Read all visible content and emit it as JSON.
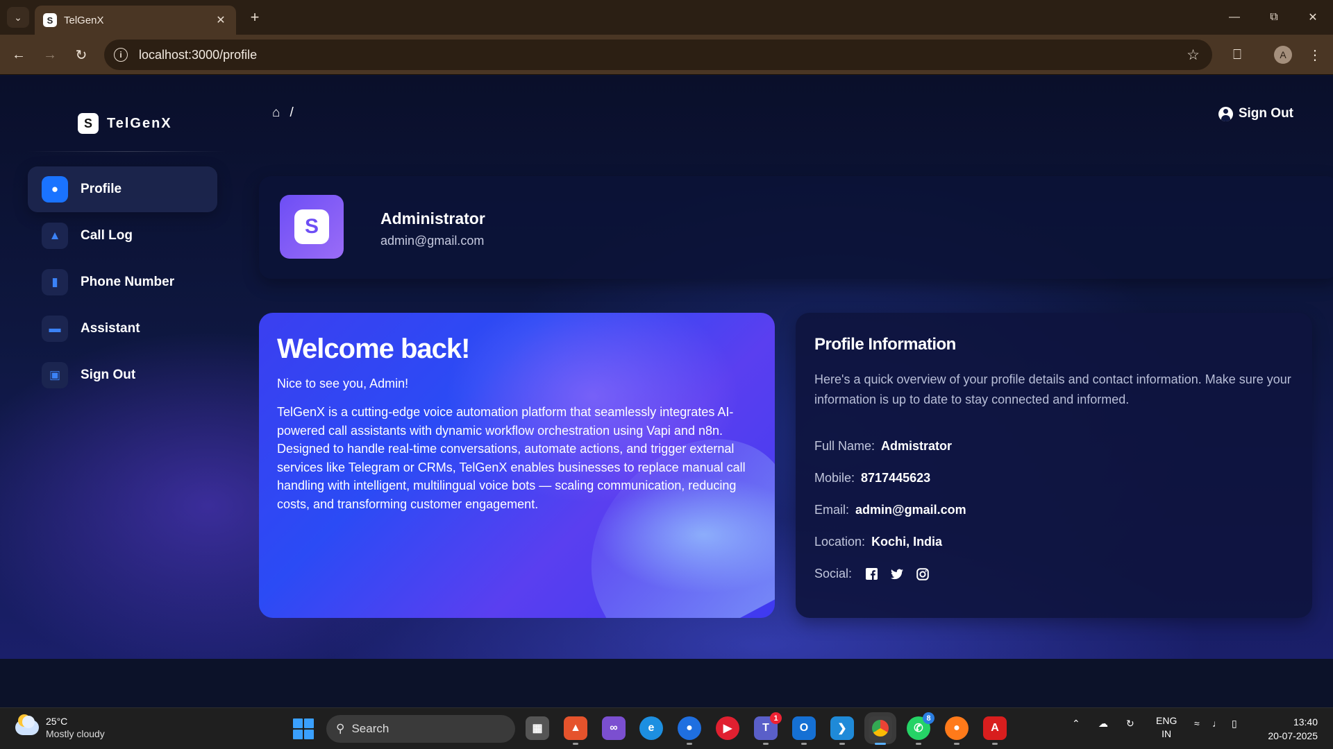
{
  "browser": {
    "tab_title": "TelGenX",
    "url": "localhost:3000/profile",
    "profile_initial": "A"
  },
  "app": {
    "brand": "TelGenX",
    "brand_logo": "S",
    "breadcrumb_sep": "/",
    "signout_top": "Sign Out",
    "sidebar": [
      {
        "label": "Profile",
        "icon": "user-icon",
        "active": true
      },
      {
        "label": "Call Log",
        "icon": "megaphone-icon",
        "active": false
      },
      {
        "label": "Phone Number",
        "icon": "bar-chart-icon",
        "active": false
      },
      {
        "label": "Assistant",
        "icon": "card-icon",
        "active": false
      },
      {
        "label": "Sign Out",
        "icon": "document-icon",
        "active": false
      }
    ],
    "header": {
      "name": "Administrator",
      "email": "admin@gmail.com",
      "avatar_glyph": "S"
    },
    "welcome": {
      "title": "Welcome back!",
      "subtitle": "Nice to see you, Admin!",
      "body": "TelGenX is a cutting-edge voice automation platform that seamlessly integrates AI-powered call assistants with dynamic workflow orchestration using Vapi and n8n. Designed to handle real-time conversations, automate actions, and trigger external services like Telegram or CRMs, TelGenX enables businesses to replace manual call handling with intelligent, multilingual voice bots — scaling communication, reducing costs, and transforming customer engagement."
    },
    "profile_info": {
      "title": "Profile Information",
      "description": "Here's a quick overview of your profile details and contact information. Make sure your information is up to date to stay connected and informed.",
      "full_name_label": "Full Name:",
      "full_name": "Admistrator",
      "mobile_label": "Mobile:",
      "mobile": "8717445623",
      "email_label": "Email:",
      "email": "admin@gmail.com",
      "location_label": "Location:",
      "location": "Kochi, India",
      "social_label": "Social:",
      "social": [
        "facebook-icon",
        "twitter-icon",
        "instagram-icon"
      ]
    }
  },
  "taskbar": {
    "temperature": "25°C",
    "weather": "Mostly cloudy",
    "search": "Search",
    "lang": "ENG",
    "region": "IN",
    "time": "13:40",
    "date": "20-07-2025",
    "teams_badge": "1",
    "whatsapp_badge": "8"
  },
  "colors": {
    "accent": "#1a73ff",
    "page_bg": "#0e1740",
    "card_bg": "#0e143e",
    "welcome_gradient": "#3b3ff0"
  }
}
